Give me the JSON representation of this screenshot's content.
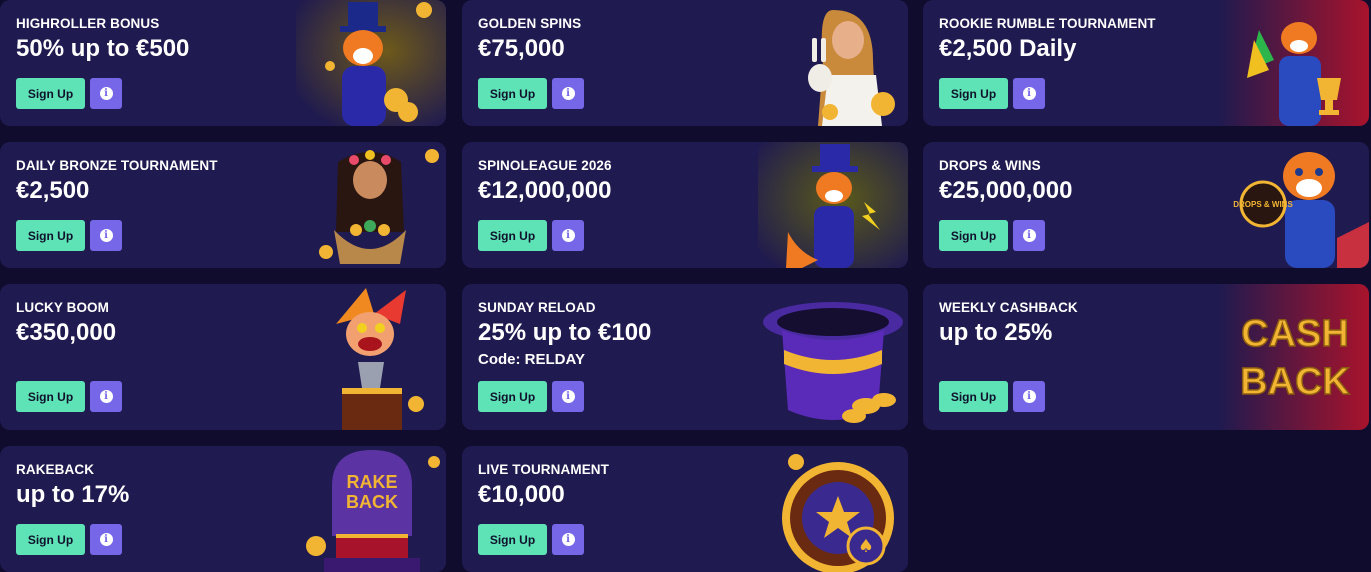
{
  "promotions": [
    {
      "title": "HIGHROLLER BONUS",
      "value": "50% up to €500",
      "sign_up": "Sign Up",
      "info_icon": "info-icon",
      "art": "fox-with-top-hat"
    },
    {
      "title": "GOLDEN SPINS",
      "value": "€75,000",
      "sign_up": "Sign Up",
      "info_icon": "info-icon",
      "art": "woman-with-rabbit"
    },
    {
      "title": "ROOKIE RUMBLE TOURNAMENT",
      "value": "€2,500 Daily",
      "sign_up": "Sign Up",
      "info_icon": "info-icon",
      "art": "fox-with-trophy"
    },
    {
      "title": "DAILY BRONZE TOURNAMENT",
      "value": "€2,500",
      "sign_up": "Sign Up",
      "info_icon": "info-icon",
      "art": "woman-with-basket"
    },
    {
      "title": "SPINOLEAGUE 2026",
      "value": "€12,000,000",
      "sign_up": "Sign Up",
      "info_icon": "info-icon",
      "art": "fox-magician"
    },
    {
      "title": "DROPS & WINS",
      "value": "€25,000,000",
      "sign_up": "Sign Up",
      "info_icon": "info-icon",
      "art": "fox-drops-and-wins"
    },
    {
      "title": "LUCKY BOOM",
      "value": "€350,000",
      "sign_up": "Sign Up",
      "info_icon": "info-icon",
      "art": "jester-in-box"
    },
    {
      "title": "SUNDAY RELOAD",
      "value": "25% up to €100",
      "code": "Code: RELDAY",
      "sign_up": "Sign Up",
      "info_icon": "info-icon",
      "art": "magic-top-hat"
    },
    {
      "title": "WEEKLY CASHBACK",
      "value": "up to 25%",
      "sign_up": "Sign Up",
      "info_icon": "info-icon",
      "art": "cash-back-lettering"
    },
    {
      "title": "RAKEBACK",
      "value": "up to 17%",
      "sign_up": "Sign Up",
      "info_icon": "info-icon",
      "art": "rakeback-dome"
    },
    {
      "title": "LIVE TOURNAMENT",
      "value": "€10,000",
      "sign_up": "Sign Up",
      "info_icon": "info-icon",
      "art": "roulette-wheel"
    }
  ],
  "art_text": {
    "drops_wins": "DROPS & WINS",
    "cash": "CASH",
    "back": "BACK",
    "rake": "RAKE",
    "rake_back": "BACK"
  },
  "colors": {
    "page_bg": "#100c2e",
    "card_bg": "#1f1a4f",
    "sign_up_bg": "#5ee3b6",
    "info_bg": "#7567e8",
    "gold": "#f2b533"
  }
}
